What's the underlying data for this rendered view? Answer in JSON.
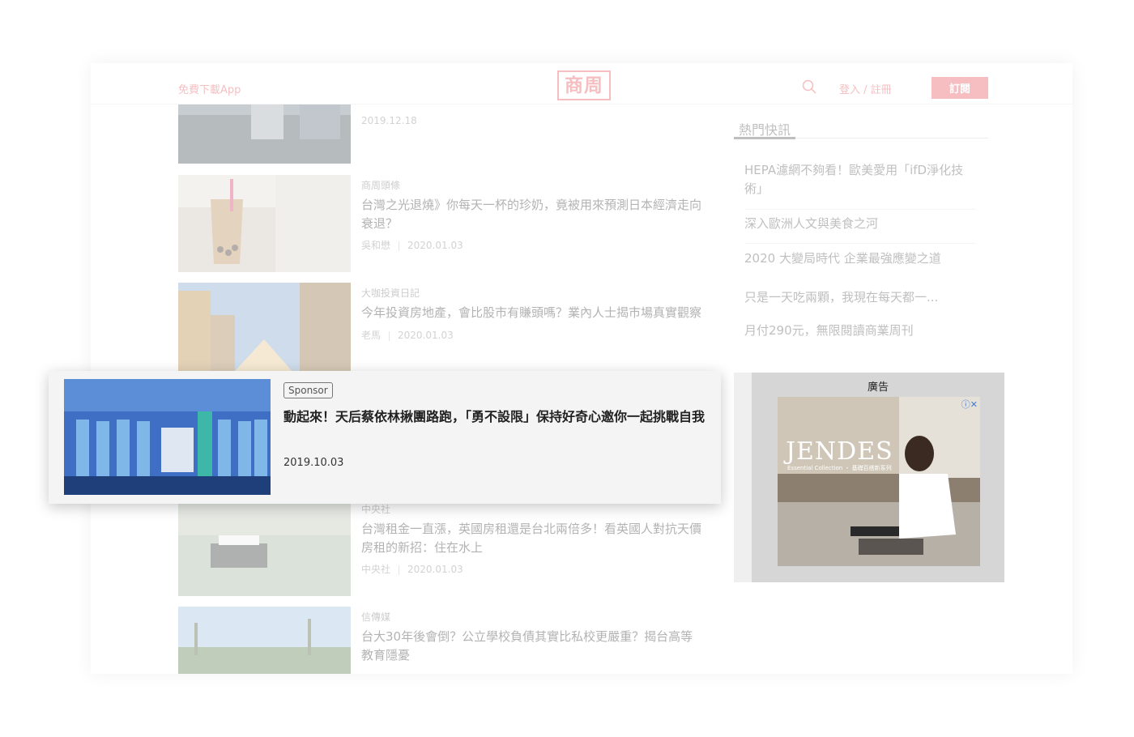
{
  "header": {
    "app_download": "免費下載App",
    "logo_text": "商周",
    "login": "登入 / 註冊",
    "subscribe": "訂閱"
  },
  "articles": [
    {
      "category": "",
      "title": "",
      "date": "2019.12.18",
      "author": ""
    },
    {
      "category": "商周頭條",
      "title": "台灣之光退燒》你每天一杯的珍奶，竟被用來預測日本經濟走向衰退？",
      "author": "吳和懋",
      "date": "2020.01.03"
    },
    {
      "category": "大咖投資日記",
      "title": "今年投資房地產，會比股市有賺頭嗎？業內人士揭市場真實觀察",
      "author": "老馬",
      "date": "2020.01.03"
    },
    {
      "category": "中央社",
      "title": "台灣租金一直漲，英國房租還是台北兩倍多！看英國人對抗天價房租的新招：住在水上",
      "author": "中央社",
      "date": "2020.01.03"
    },
    {
      "category": "信傳媒",
      "title": "台大30年後會倒？公立學校負債其實比私校更嚴重？揭台高等教育隱憂",
      "author": "",
      "date": ""
    }
  ],
  "sidebar": {
    "hot_title": "熱門快訊",
    "hot_items": [
      "HEPA濾網不夠看！歐美愛用「ifD淨化技術」",
      "深入歐洲人文與美食之河",
      "2020 大變局時代 企業最強應變之道",
      "只是一天吃兩顆，我現在每天都一...",
      "月付290元，無限閱讀商業周刊"
    ],
    "ad_label": "廣告",
    "ad_brand": "JENDES",
    "ad_subtitle": "Essential Collection ・ 基礎百搭新系列"
  },
  "sponsored": {
    "badge": "Sponsor",
    "title": "動起來！天后蔡依林揪團路跑，「勇不設限」保持好奇心邀你一起挑戰自我",
    "date": "2019.10.03"
  },
  "colors": {
    "brand": "#e8535a",
    "card_bg": "#f4f4f4",
    "ad_bg": "#d6d6d6"
  }
}
